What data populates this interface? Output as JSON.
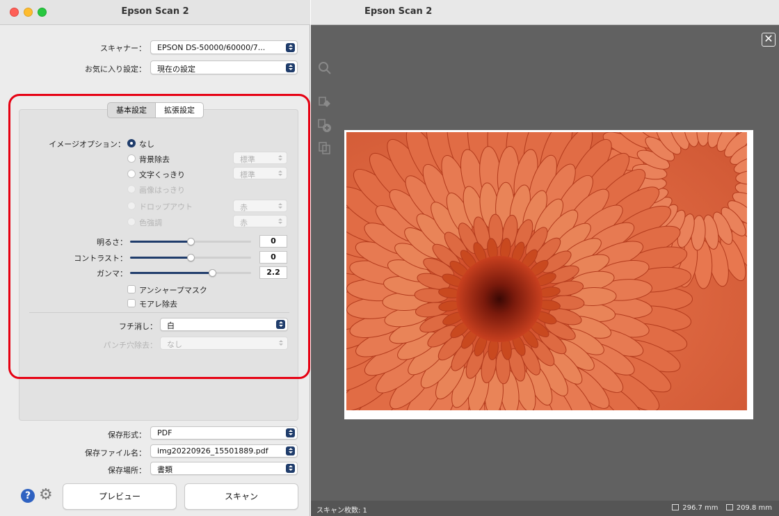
{
  "left_window": {
    "title": "Epson Scan 2",
    "scanner": {
      "label": "スキャナー：",
      "value": "EPSON DS-50000/60000/7..."
    },
    "favorites": {
      "label": "お気に入り設定：",
      "value": "現在の設定"
    },
    "tabs": [
      {
        "label": "基本設定",
        "selected": true
      },
      {
        "label": "拡張設定",
        "selected": false
      }
    ],
    "image_option": {
      "label": "イメージオプション：",
      "options": [
        {
          "label": "なし",
          "selected": true,
          "enabled": true
        },
        {
          "label": "背景除去",
          "selected": false,
          "enabled": true,
          "select_value": "標準",
          "select_enabled": false
        },
        {
          "label": "文字くっきり",
          "selected": false,
          "enabled": true,
          "select_value": "標準",
          "select_enabled": false
        },
        {
          "label": "画像はっきり",
          "selected": false,
          "enabled": false
        },
        {
          "label": "ドロップアウト",
          "selected": false,
          "enabled": false,
          "select_value": "赤",
          "select_enabled": false
        },
        {
          "label": "色強調",
          "selected": false,
          "enabled": false,
          "select_value": "赤",
          "select_enabled": false
        }
      ]
    },
    "brightness": {
      "label": "明るさ：",
      "value": "0",
      "level": 0.5
    },
    "contrast": {
      "label": "コントラスト：",
      "value": "0",
      "level": 0.5
    },
    "gamma": {
      "label": "ガンマ：",
      "value": "2.2",
      "level": 0.68
    },
    "unsharp_mask": {
      "label": "アンシャープマスク",
      "checked": false
    },
    "moire_removal": {
      "label": "モアレ除去",
      "checked": false
    },
    "edge_fill": {
      "label": "フチ消し：",
      "value": "白"
    },
    "punch_hole": {
      "label": "パンチ穴除去：",
      "value": "なし",
      "enabled": false
    },
    "image_format": {
      "label": "保存形式：",
      "value": "PDF"
    },
    "file_name": {
      "label": "保存ファイル名：",
      "value": "img20220926_15501889.pdf"
    },
    "folder": {
      "label": "保存場所：",
      "value": "書類"
    },
    "preview_button": "プレビュー",
    "scan_button": "スキャン",
    "highlight_color": "#e60012",
    "accent_color": "#1f3c6b"
  },
  "right_window": {
    "title": "Epson Scan 2",
    "tool_icons": [
      "zoom-icon",
      "auto-crop-icon",
      "add-area-icon",
      "copy-area-icon"
    ],
    "status": {
      "scan_count": "スキャン枚数: 1",
      "width": "296.7 mm",
      "height": "209.8 mm"
    }
  }
}
